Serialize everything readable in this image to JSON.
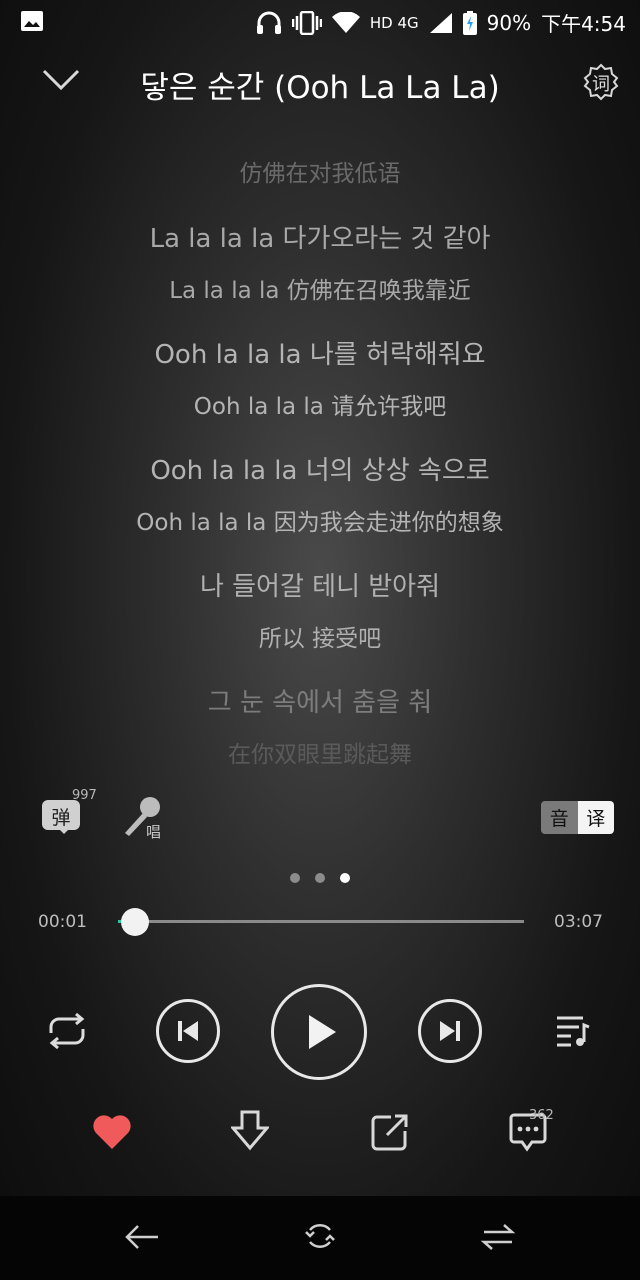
{
  "status_bar": {
    "network": "HD 4G",
    "battery": "90%",
    "time": "下午4:54"
  },
  "header": {
    "title": "닿은 순간 (Ooh La La La)",
    "lyrics_button_label": "词"
  },
  "lyrics": [
    {
      "ko": "",
      "zh": "仿佛在对我低语"
    },
    {
      "ko": "La la la la 다가오라는 것 같아",
      "zh": "La la la la 仿佛在召唤我靠近"
    },
    {
      "ko": "Ooh la la la 나를 허락해줘요",
      "zh": "Ooh la la la 请允许我吧"
    },
    {
      "ko": "Ooh la la la 너의 상상 속으로",
      "zh": "Ooh la la la 因为我会走进你的想象"
    },
    {
      "ko": "나 들어갈 테니 받아줘",
      "zh": "所以 接受吧"
    },
    {
      "ko": "그 눈 속에서 춤을 춰",
      "zh": "在你双眼里跳起舞"
    }
  ],
  "toolbar": {
    "danmaku_label": "弹",
    "danmaku_count": "997",
    "sing_label": "唱",
    "lang_original": "音",
    "lang_translation": "译"
  },
  "pager": {
    "pages": 3,
    "active": 3
  },
  "player": {
    "current_time": "00:01",
    "total_time": "03:07",
    "progress": 0.005
  },
  "actions": {
    "comment_count": "362"
  },
  "colors": {
    "like": "#f05a5a",
    "accent": "#2ec3a0"
  }
}
